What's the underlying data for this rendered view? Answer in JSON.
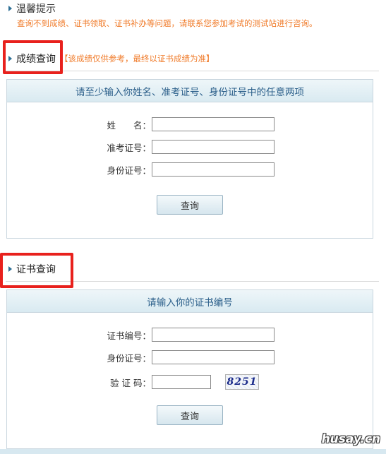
{
  "tip": {
    "title": "温馨提示",
    "text": "查询不到成绩、证书领取、证书补办等问题，请联系您参加考试的测试站进行咨询。"
  },
  "score_section": {
    "title": "成绩查询",
    "note": "【该成绩仅供参考，最终以证书成绩为准】",
    "panel_title": "请至少输入你姓名、准考证号、身份证号中的任意两项",
    "fields": [
      {
        "label": "姓　　名：",
        "value": ""
      },
      {
        "label": "准考证号：",
        "value": ""
      },
      {
        "label": "身份证号：",
        "value": ""
      }
    ],
    "button": "查询"
  },
  "cert_section": {
    "title": "证书查询",
    "panel_title": "请输入你的证书编号",
    "fields": [
      {
        "label": "证书编号：",
        "value": ""
      },
      {
        "label": "身份证号：",
        "value": ""
      },
      {
        "label": "验 证 码：",
        "value": ""
      }
    ],
    "captcha": "8251",
    "button": "查询"
  },
  "watermark": "husay.cn",
  "colors": {
    "accent_orange": "#f07b2a",
    "highlight_red": "#e8211d",
    "panel_title_blue": "#2b5f8a"
  }
}
